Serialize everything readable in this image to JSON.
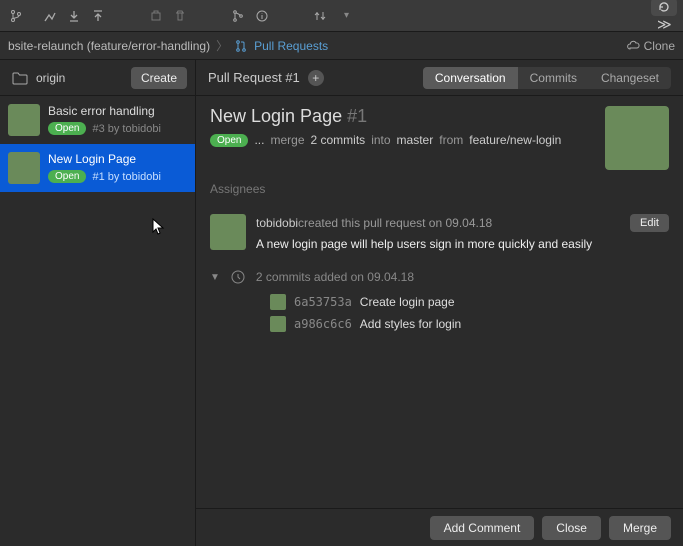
{
  "breadcrumb": {
    "repo": "bsite-relaunch (feature/error-handling)",
    "section": "Pull Requests",
    "clone": "Clone"
  },
  "sidebar": {
    "origin": "origin",
    "create": "Create",
    "items": [
      {
        "title": "Basic error handling",
        "badge": "Open",
        "sub": "#3 by tobidobi"
      },
      {
        "title": "New Login Page",
        "badge": "Open",
        "sub": "#1 by tobidobi"
      }
    ]
  },
  "main": {
    "header_title": "Pull Request #1",
    "tabs": {
      "conversation": "Conversation",
      "commits": "Commits",
      "changeset": "Changeset"
    },
    "title": "New Login Page",
    "number": "#1",
    "badge": "Open",
    "mergeline": {
      "ellipsis": "...",
      "merge": "merge",
      "count": "2 commits",
      "into": "into",
      "base": "master",
      "from": "from",
      "source": "feature/new-login"
    },
    "assignees_label": "Assignees",
    "event": {
      "user": "tobidobi",
      "rest": " created this pull request on 09.04.18",
      "desc": "A new login page will help users sign in more quickly and easily",
      "edit": "Edit"
    },
    "commits": {
      "header": "2 commits added on 09.04.18",
      "list": [
        {
          "hash": "6a53753a",
          "msg": "Create login page"
        },
        {
          "hash": "a986c6c6",
          "msg": "Add styles for login"
        }
      ]
    },
    "footer": {
      "add_comment": "Add Comment",
      "close": "Close",
      "merge": "Merge"
    }
  }
}
